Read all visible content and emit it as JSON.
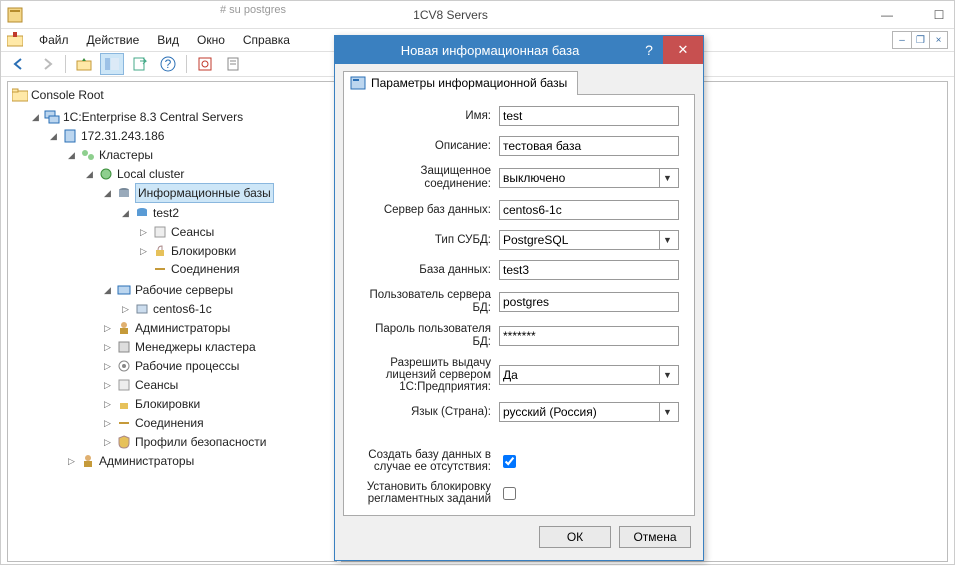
{
  "titlebar": {
    "title": "1CV8 Servers"
  },
  "menu": {
    "file": "Файл",
    "action": "Действие",
    "view": "Вид",
    "window": "Окно",
    "help": "Справка"
  },
  "tree": {
    "root": "Console Root",
    "central_servers": "1C:Enterprise 8.3 Central Servers",
    "server_ip": "172.31.243.186",
    "clusters": "Кластеры",
    "local_cluster": "Local cluster",
    "infobases": "Информационные базы",
    "ib_test2": "test2",
    "sessions": "Сеансы",
    "locks": "Блокировки",
    "connections": "Соединения",
    "working_servers": "Рабочие серверы",
    "ws_centos": "centos6-1c",
    "admins": "Администраторы",
    "cluster_managers": "Менеджеры кластера",
    "working_processes": "Рабочие процессы",
    "sessions2": "Сеансы",
    "locks2": "Блокировки",
    "connections2": "Соединения",
    "security_profiles": "Профили безопасности",
    "admins2": "Администраторы"
  },
  "dialog": {
    "title": "Новая информационная база",
    "tab": "Параметры информационной базы",
    "labels": {
      "name": "Имя:",
      "desc": "Описание:",
      "secure": "Защищенное соединение:",
      "dbserver": "Сервер баз данных:",
      "dbtype": "Тип СУБД:",
      "dbname": "База данных:",
      "dbuser": "Пользователь сервера БД:",
      "dbpass": "Пароль пользователя БД:",
      "license": "Разрешить выдачу лицензий сервером 1С:Предприятия:",
      "lang": "Язык (Страна):",
      "create": "Создать базу данных в случае ее отсутствия:",
      "block": "Установить блокировку регламентных заданий"
    },
    "values": {
      "name": "test",
      "desc": "тестовая база",
      "secure": "выключено",
      "dbserver": "centos6-1c",
      "dbtype": "PostgreSQL",
      "dbname": "test3",
      "dbuser": "postgres",
      "dbpass": "*******",
      "license": "Да",
      "lang": "русский (Россия)"
    },
    "buttons": {
      "ok": "ОК",
      "cancel": "Отмена"
    }
  },
  "top_snippet": "# su postgres"
}
